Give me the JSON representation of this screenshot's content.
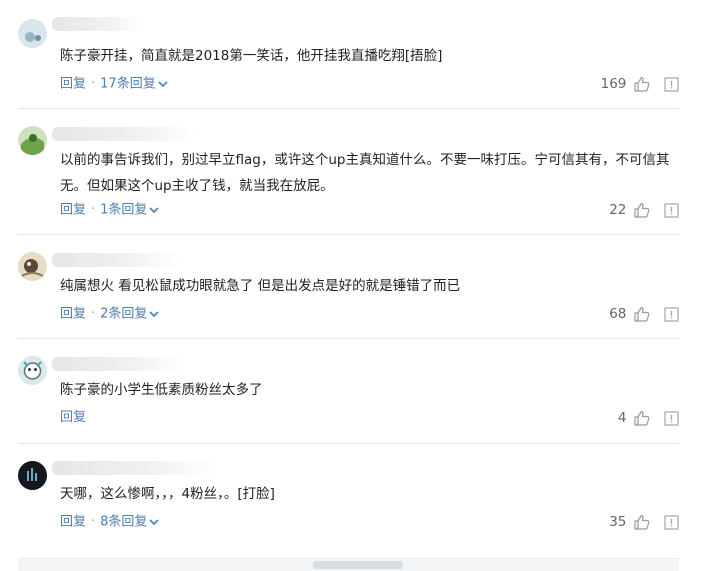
{
  "comments": [
    {
      "username": "",
      "text": "陈子豪开挂，简直就是2018第一笑话，他开挂我直播吃翔[捂脸]",
      "reply_label": "回复",
      "replies_label": "17条回复",
      "likes": "169"
    },
    {
      "username": "",
      "text": "以前的事告诉我们，别过早立flag，或许这个up主真知道什么。不要一味打压。宁可信其有，不可信其无。但如果这个up主收了钱，就当我在放屁。",
      "reply_label": "回复",
      "replies_label": "1条回复",
      "likes": "22"
    },
    {
      "username": "",
      "text": "纯属想火 看见松鼠成功眼就急了 但是出发点是好的就是锤错了而已",
      "reply_label": "回复",
      "replies_label": "2条回复",
      "likes": "68"
    },
    {
      "username": "",
      "text": "陈子豪的小学生低素质粉丝太多了",
      "reply_label": "回复",
      "replies_label": "",
      "likes": "4"
    },
    {
      "username": "",
      "text": "天哪，这么惨啊，，，4粉丝，。[打脸]",
      "reply_label": "回复",
      "replies_label": "8条回复",
      "likes": "35"
    }
  ],
  "icons": {
    "like": "thumbs-up-icon",
    "report": "report-icon",
    "expand": "chevron-down-icon"
  },
  "colors": {
    "link": "#507daf",
    "text": "#222222",
    "count": "#666666",
    "divider": "#e5e5e5"
  }
}
